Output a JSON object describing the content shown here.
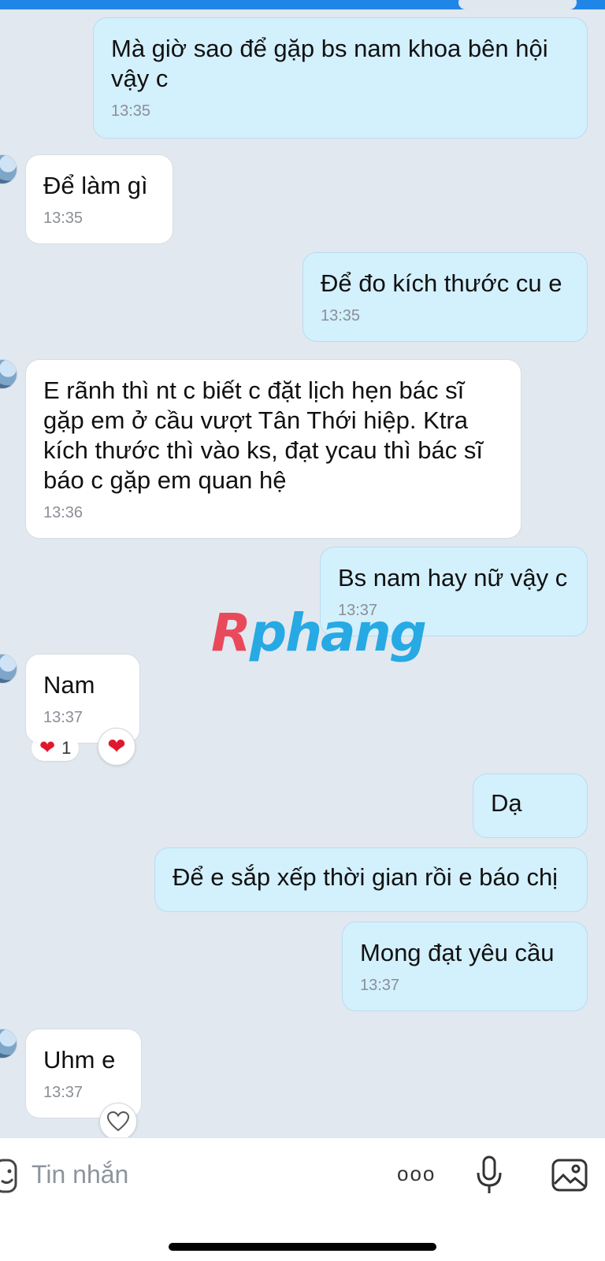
{
  "messages": [
    {
      "text": "Mà giờ sao để gặp bs nam khoa bên hội\nvậy c",
      "time": "13:35"
    },
    {
      "text": "Để làm gì",
      "time": "13:35"
    },
    {
      "text": "Để đo kích thước cu e",
      "time": "13:35"
    },
    {
      "text": "E rãnh thì nt c biết c đặt lịch hẹn bác sĩ\ngặp em ở cầu vượt Tân Thới hiệp. Ktra\nkích thước thì vào ks, đạt ycau thì bác sĩ\nbáo c gặp em quan hệ",
      "time": "13:36"
    },
    {
      "text": "Bs nam hay nữ vậy c",
      "time": "13:37"
    },
    {
      "text": "Nam",
      "time": "13:37",
      "reaction_count": "1"
    },
    {
      "text": "Dạ"
    },
    {
      "text": "Để e sắp xếp thời gian rồi e báo chị"
    },
    {
      "text": "Mong đạt yêu cầu",
      "time": "13:37"
    },
    {
      "text": "Uhm e",
      "time": "13:37"
    }
  ],
  "watermark": {
    "first": "R",
    "rest": "phang"
  },
  "composer": {
    "placeholder": "Tin nhắn",
    "more_label": "ooo"
  },
  "colors": {
    "outgoing_bubble": "#d3f0fd",
    "incoming_bubble": "#ffffff",
    "background": "#e2e8f0",
    "heart": "#e0182d"
  },
  "icons": [
    "sticker-icon",
    "more-icon",
    "microphone-icon",
    "image-icon",
    "heart-icon",
    "heart-outline-icon"
  ]
}
